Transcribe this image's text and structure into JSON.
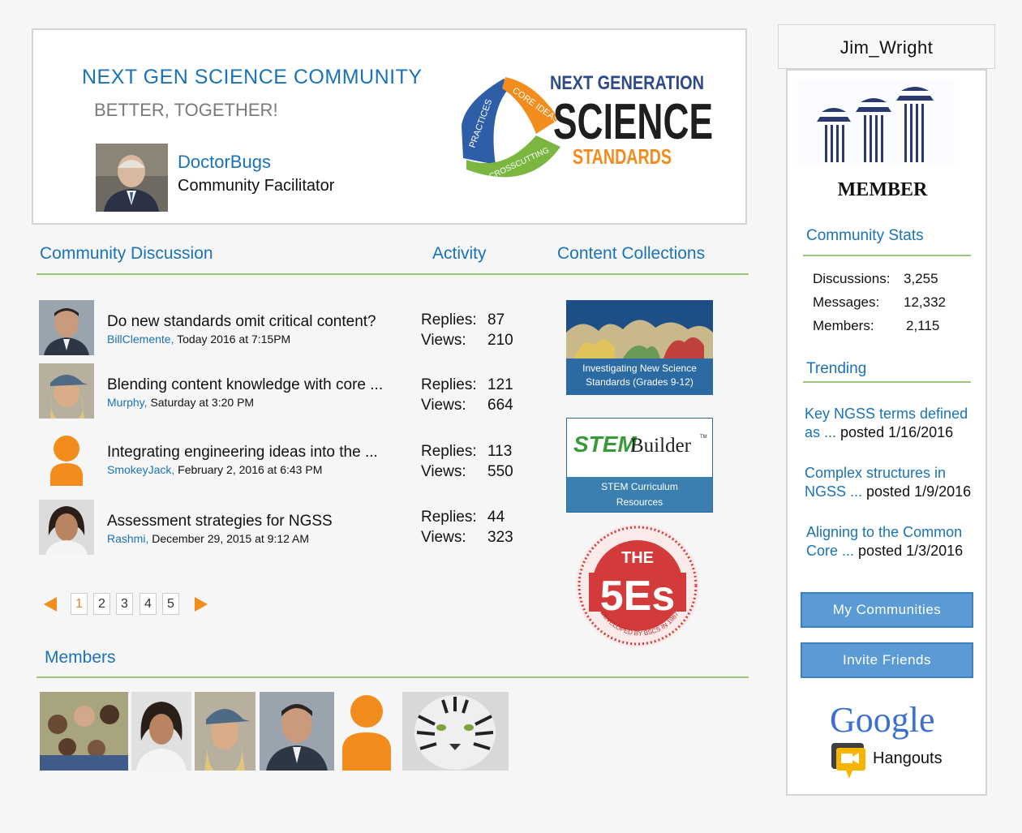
{
  "header": {
    "title": "NEXT GEN SCIENCE COMMUNITY",
    "subtitle": "BETTER, TOGETHER!",
    "facilitator_name": "DoctorBugs",
    "facilitator_role": "Community Facilitator"
  },
  "ngss_logo": {
    "line1": "NEXT GENERATION",
    "line2": "SCIENCE",
    "line3": "STANDARDS",
    "seg1": "PRACTICES",
    "seg2": "CORE IDEAS",
    "seg3": "CROSSCUTTING"
  },
  "sections": {
    "discussion": "Community Discussion",
    "activity": "Activity",
    "collections": "Content Collections",
    "members": "Members"
  },
  "discussions": [
    {
      "title": "Do new standards omit critical content?",
      "user": "BillClemente,",
      "when": "Today 2016 at 7:15PM",
      "replies_label": "Replies:",
      "replies": "87",
      "views_label": "Views:",
      "views": "210"
    },
    {
      "title": "Blending content knowledge with core ...",
      "user": "Murphy,",
      "when": "Saturday at 3:20 PM",
      "replies_label": "Replies:",
      "replies": "121",
      "views_label": "Views:",
      "views": "664"
    },
    {
      "title": "Integrating engineering ideas into the ...",
      "user": "SmokeyJack,",
      "when": "February 2, 2016 at 6:43 PM",
      "replies_label": "Replies:",
      "replies": "113",
      "views_label": "Views:",
      "views": "550"
    },
    {
      "title": "Assessment strategies for NGSS",
      "user": "Rashmi,",
      "when": "December 29, 2015 at 9:12 AM",
      "replies_label": "Replies:",
      "replies": "44",
      "views_label": "Views:",
      "views": "323"
    }
  ],
  "pagination": {
    "pages": [
      "1",
      "2",
      "3",
      "4",
      "5"
    ],
    "current": "1"
  },
  "collections": [
    {
      "caption1": "Investigating New Science",
      "caption2": "Standards (Grades 9-12)"
    },
    {
      "brand1": "STEM",
      "brand2": "Builder",
      "tm": "TM",
      "caption1": "STEM Curriculum",
      "caption2": "Resources"
    },
    {
      "badge_top": "THE",
      "badge_main": "5Es",
      "badge_ring": "DEVELOPED BY BSCS IN 1987"
    }
  ],
  "sidebar": {
    "username": "Jim_Wright",
    "badge": "MEMBER",
    "stats_title": "Community Stats",
    "stats": [
      {
        "label": "Discussions:",
        "value": "3,255"
      },
      {
        "label": "Messages:",
        "value": "12,332"
      },
      {
        "label": "Members:",
        "value": "2,115"
      }
    ],
    "trending_title": "Trending",
    "trending": [
      {
        "link": "Key NGSS terms defined as ...",
        "posted": "posted 1/16/2016"
      },
      {
        "link": "Complex structures in NGSS ...",
        "posted": "posted 1/9/2016"
      },
      {
        "link": "Aligning to the Common Core ...",
        "posted": "posted 1/3/2016"
      }
    ],
    "my_communities": "My Communities",
    "invite_friends": "Invite Friends",
    "google": "Google",
    "hangouts": "Hangouts"
  },
  "colors": {
    "accent_blue": "#1a73b8",
    "rule_green": "#9cc67a",
    "orange": "#f28c1c",
    "button_blue": "#5b9bd5"
  }
}
